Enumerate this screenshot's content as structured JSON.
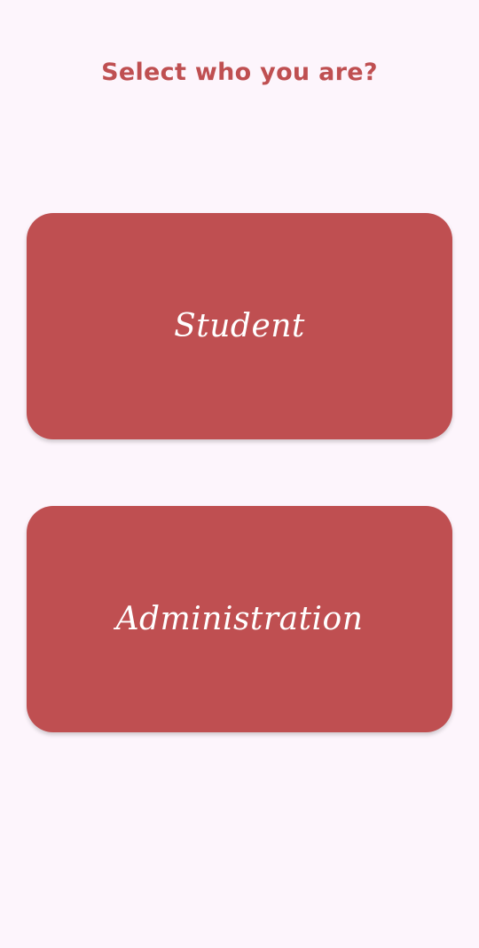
{
  "header": {
    "title": "Select who you are?"
  },
  "options": {
    "student_label": "Student",
    "admin_label": "Administration"
  },
  "colors": {
    "background": "#fdf5fc",
    "accent": "#bf4f51",
    "card_text": "#ffffff"
  }
}
